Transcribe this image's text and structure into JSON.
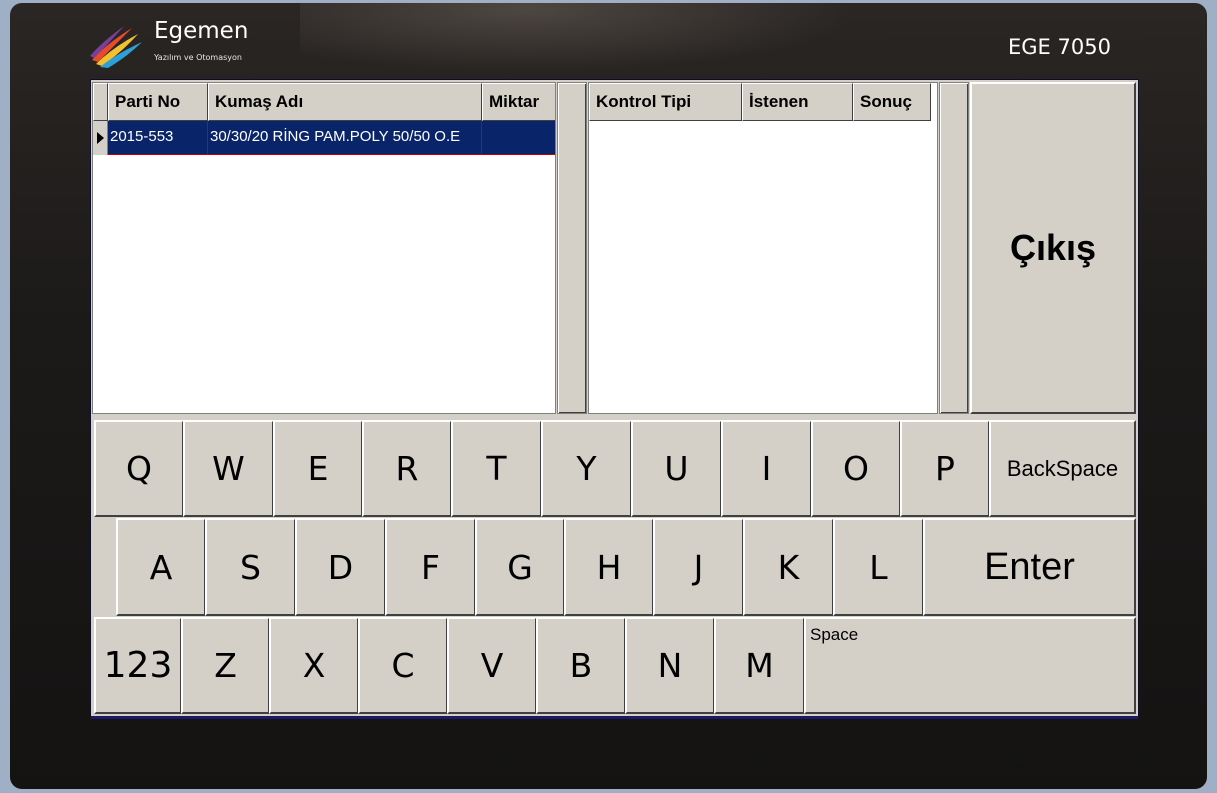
{
  "device": {
    "brand": "Egemen",
    "tagline": "Yazılım ve Otomasyon",
    "model": "EGE 7050"
  },
  "lot_grid": {
    "columns": [
      "Parti No",
      "Kumaş Adı",
      "Miktar"
    ],
    "rows": [
      {
        "parti_no": "2015-553",
        "kumas_adi": "30/30/20 RİNG PAM.POLY 50/50 O.E",
        "miktar": "",
        "selected": true
      }
    ]
  },
  "control_grid": {
    "columns": [
      "Kontrol Tipi",
      "İstenen",
      "Sonuç"
    ],
    "rows": []
  },
  "exit_label": "Çıkış",
  "keyboard": {
    "row1": [
      "Q",
      "W",
      "E",
      "R",
      "T",
      "Y",
      "U",
      "I",
      "O",
      "P"
    ],
    "backspace": "BackSpace",
    "row2": [
      "A",
      "S",
      "D",
      "F",
      "G",
      "H",
      "J",
      "K",
      "L"
    ],
    "enter": "Enter",
    "numbers": "123",
    "row3": [
      "Z",
      "X",
      "C",
      "V",
      "B",
      "N",
      "M"
    ],
    "space": "Space"
  },
  "colors": {
    "panel": "#d4d0c8",
    "selection": "#0a246a",
    "selection_border": "#c00000",
    "bezel": "#1c1a19"
  }
}
